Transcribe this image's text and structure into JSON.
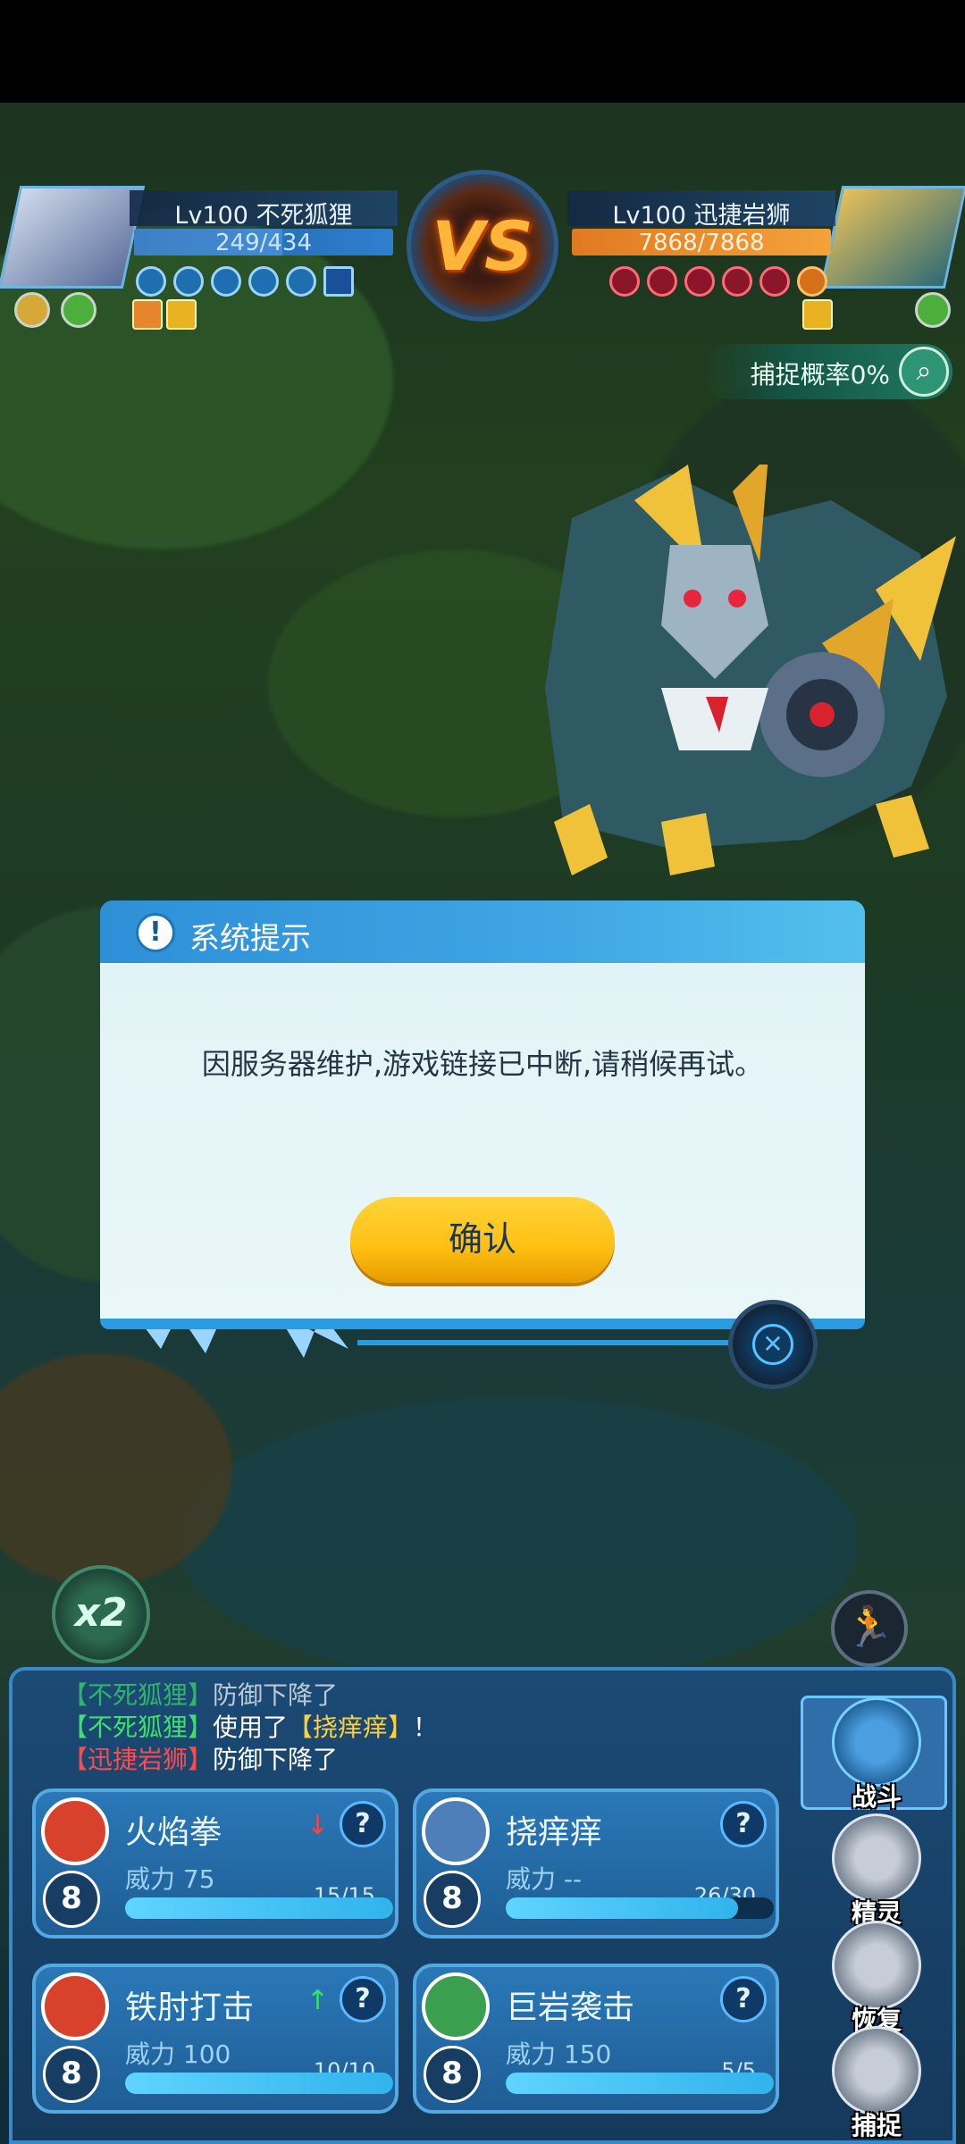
{
  "player": {
    "name": "Lv100 不死狐狸",
    "hp": "249/434",
    "hp_fraction": 0.574
  },
  "enemy": {
    "name": "Lv100 迅捷岩狮",
    "hp": "7868/7868",
    "hp_fraction": 1.0
  },
  "vs_label": "VS",
  "catch_rate": "捕捉概率0%",
  "dialog": {
    "title": "系统提示",
    "message": "因服务器维护,游戏链接已中断,请稍候再试。",
    "confirm_label": "确认"
  },
  "speed_label": "x2",
  "battle_log": [
    {
      "name": "【不死狐狸】",
      "name_color": "green",
      "text": "防御下降了"
    },
    {
      "name": "【不死狐狸】",
      "name_color": "green",
      "text": "使用了",
      "skill": "【挠痒痒】",
      "tail": "！"
    },
    {
      "name": "【迅捷岩狮】",
      "name_color": "red",
      "text": "防御下降了"
    }
  ],
  "skills": [
    {
      "name": "火焰拳",
      "power": "威力 75",
      "pp": "15/15",
      "pp_fraction": 1.0,
      "cost": "8",
      "effect": "↓",
      "icon_color": "#d8412b"
    },
    {
      "name": "挠痒痒",
      "power": "威力 --",
      "pp": "26/30",
      "pp_fraction": 0.867,
      "cost": "8",
      "effect": "",
      "icon_color": "#4f7fb8"
    },
    {
      "name": "铁肘打击",
      "power": "威力 100",
      "pp": "10/10",
      "pp_fraction": 1.0,
      "cost": "8",
      "effect": "↑",
      "icon_color": "#d8412b"
    },
    {
      "name": "巨岩袭击",
      "power": "威力 150",
      "pp": "5/5",
      "pp_fraction": 1.0,
      "cost": "8",
      "effect": "",
      "icon_color": "#3aa050"
    }
  ],
  "help_label": "?",
  "side_menu": [
    {
      "label": "战斗",
      "icon": "sword-icon",
      "active": true
    },
    {
      "label": "精灵",
      "icon": "pet-icon",
      "active": false
    },
    {
      "label": "恢复",
      "icon": "potion-icon",
      "active": false
    },
    {
      "label": "捕捉",
      "icon": "capsule-icon",
      "active": false
    }
  ],
  "colors": {
    "dialog_header": "#40a6e4",
    "confirm_button": "#ffbf12",
    "player_hp": "#2e7fcf",
    "enemy_hp": "#f4a23a"
  }
}
